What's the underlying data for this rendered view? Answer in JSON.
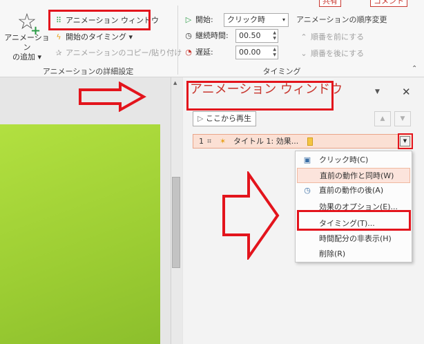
{
  "ribbon": {
    "top_buttons": [
      "共有",
      "コメント"
    ],
    "add_animation_label": [
      "アニメーション",
      "の追加"
    ],
    "animation_pane_label": "アニメーション ウィンドウ",
    "start_timing_label": "開始のタイミング",
    "anim_copy_label": "アニメーションのコピー/貼り付け",
    "group_advanced_label": "アニメーションの詳細設定",
    "start_label": "開始:",
    "start_value": "クリック時",
    "duration_label": "継続時間:",
    "duration_value": "00.50",
    "delay_label": "遅延:",
    "delay_value": "00.00",
    "reorder_label": "アニメーションの順序変更",
    "move_earlier_label": "順番を前にする",
    "move_later_label": "順番を後にする",
    "group_timing_label": "タイミング"
  },
  "pane": {
    "title": "アニメーション ウィンドウ",
    "play_from_label": "ここから再生",
    "item": {
      "number": "1",
      "name": "タイトル 1: 効果..."
    }
  },
  "menu": {
    "items": [
      {
        "label": "クリック時(C)",
        "icon": "mouse-icon"
      },
      {
        "label": "直前の動作と同時(W)"
      },
      {
        "label": "直前の動作の後(A)",
        "icon": "clock-icon"
      },
      {
        "label": "効果のオプション(E)..."
      },
      {
        "label": "タイミング(T)..."
      },
      {
        "label": "時間配分の非表示(H)"
      },
      {
        "label": "削除(R)"
      }
    ]
  },
  "colors": {
    "annotation_red": "#e3141c",
    "title_red": "#c8372f",
    "slide_green": "#a6d63a"
  }
}
